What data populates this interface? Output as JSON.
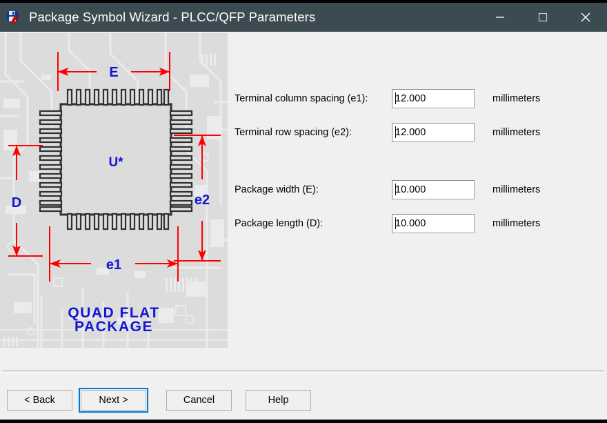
{
  "window": {
    "title": "Package Symbol Wizard - PLCC/QFP Parameters",
    "icon": "floppy-disk-red-arrow-icon",
    "titlebar_color": "#3c4b51",
    "controls": {
      "minimize": "minimize-icon",
      "maximize": "maximize-icon",
      "close": "close-icon"
    }
  },
  "package_image": {
    "component_designator": "U*",
    "caption_line1": "QUAD FLAT",
    "caption_line2": "PACKAGE",
    "dimension_labels": {
      "width_top": "E",
      "height_left": "D",
      "row_right": "e2",
      "column_bottom": "e1"
    },
    "colors": {
      "dimension": "#ff0000",
      "label": "#1414d2",
      "body_outline": "#303030",
      "background": "#dcdcdc",
      "trace": "#eaeaea"
    },
    "pins_per_side": 12
  },
  "form": {
    "fields": [
      {
        "label": "Terminal column spacing (e1):",
        "value": "12.000",
        "units": "millimeters",
        "name": "terminal-column-spacing-input"
      },
      {
        "label": "Terminal row spacing (e2):",
        "value": "12.000",
        "units": "millimeters",
        "name": "terminal-row-spacing-input"
      },
      {
        "label": "Package width (E):",
        "value": "10.000",
        "units": "millimeters",
        "name": "package-width-input"
      },
      {
        "label": "Package length (D):",
        "value": "10.000",
        "units": "millimeters",
        "name": "package-length-input"
      }
    ]
  },
  "buttons": {
    "back": "< Back",
    "next": "Next >",
    "cancel": "Cancel",
    "help": "Help",
    "focus_color": "#0078d7"
  }
}
